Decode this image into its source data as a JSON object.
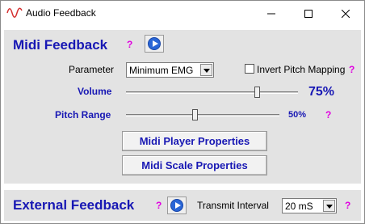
{
  "window": {
    "title": "Audio Feedback"
  },
  "midi": {
    "title": "Midi Feedback",
    "help": "?",
    "parameter_label": "Parameter",
    "parameter_value": "Minimum EMG",
    "invert_label": "Invert Pitch Mapping",
    "invert_checked": false,
    "invert_help": "?",
    "volume_label": "Volume",
    "volume_value": "75%",
    "volume_level": 0.75,
    "pitch_label": "Pitch Range",
    "pitch_value": "50%",
    "pitch_level": 0.5,
    "pitch_help": "?",
    "player_button": "Midi Player Properties",
    "scale_button": "Midi Scale Properties"
  },
  "external": {
    "title": "External Feedback",
    "help": "?",
    "interval_label": "Transmit Interval",
    "interval_value": "20 mS",
    "interval_help": "?"
  },
  "colors": {
    "accent": "#1818b4",
    "help": "#e000e0",
    "panel": "#e3e3e3"
  }
}
